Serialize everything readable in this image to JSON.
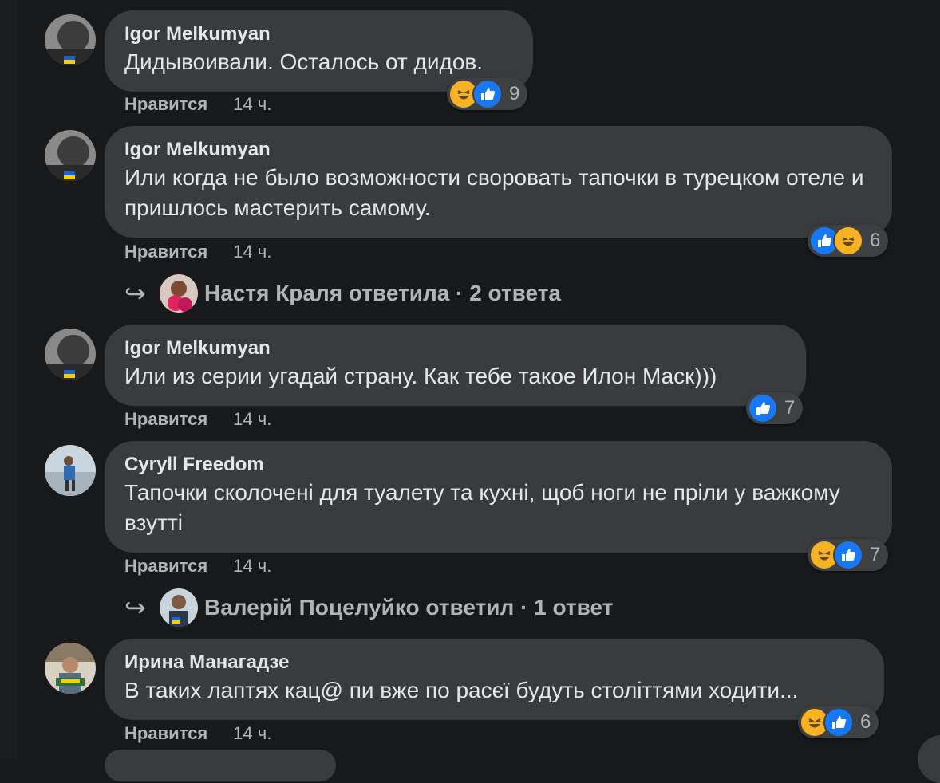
{
  "comments": [
    {
      "author": "Igor Melkumyan",
      "text": "Дидывоивали. Осталось от дидов.",
      "reactions": [
        "haha",
        "like"
      ],
      "reaction_count": "9",
      "like_label": "Нравится",
      "time": "14 ч."
    },
    {
      "author": "Igor Melkumyan",
      "text": "Или когда не было возможности своровать тапочки в турецком отеле и пришлось мастерить самому.",
      "reactions": [
        "like",
        "haha"
      ],
      "reaction_count": "6",
      "like_label": "Нравится",
      "time": "14 ч.",
      "replies": "Настя Краля ответила · 2 ответа"
    },
    {
      "author": "Igor Melkumyan",
      "text": "Или из серии угадай страну. Как тебе такое Илон Маск)))",
      "reactions": [
        "like"
      ],
      "reaction_count": "7",
      "like_label": "Нравится",
      "time": "14 ч."
    },
    {
      "author": "Cyryll Freedom",
      "text": "Тапочки сколочені для туалету та кухні, щоб ноги не пріли у важкому взутті",
      "reactions": [
        "haha",
        "like"
      ],
      "reaction_count": "7",
      "like_label": "Нравится",
      "time": "14 ч.",
      "replies": "Валерій Поцелуйко ответил · 1 ответ"
    },
    {
      "author": "Ирина Манагадзе",
      "text": "В таких лаптях кац@ пи вже по расєї будуть століттями ходити...",
      "reactions": [
        "haha",
        "like"
      ],
      "reaction_count": "6",
      "like_label": "Нравится",
      "time": "14 ч."
    }
  ],
  "reply_arrow_icon": "reply-arrow-icon",
  "colors": {
    "background": "#18191a",
    "bubble": "#3a3b3c",
    "like": "#1877f2",
    "haha": "#f7b125",
    "muted": "#b0b3b8"
  }
}
